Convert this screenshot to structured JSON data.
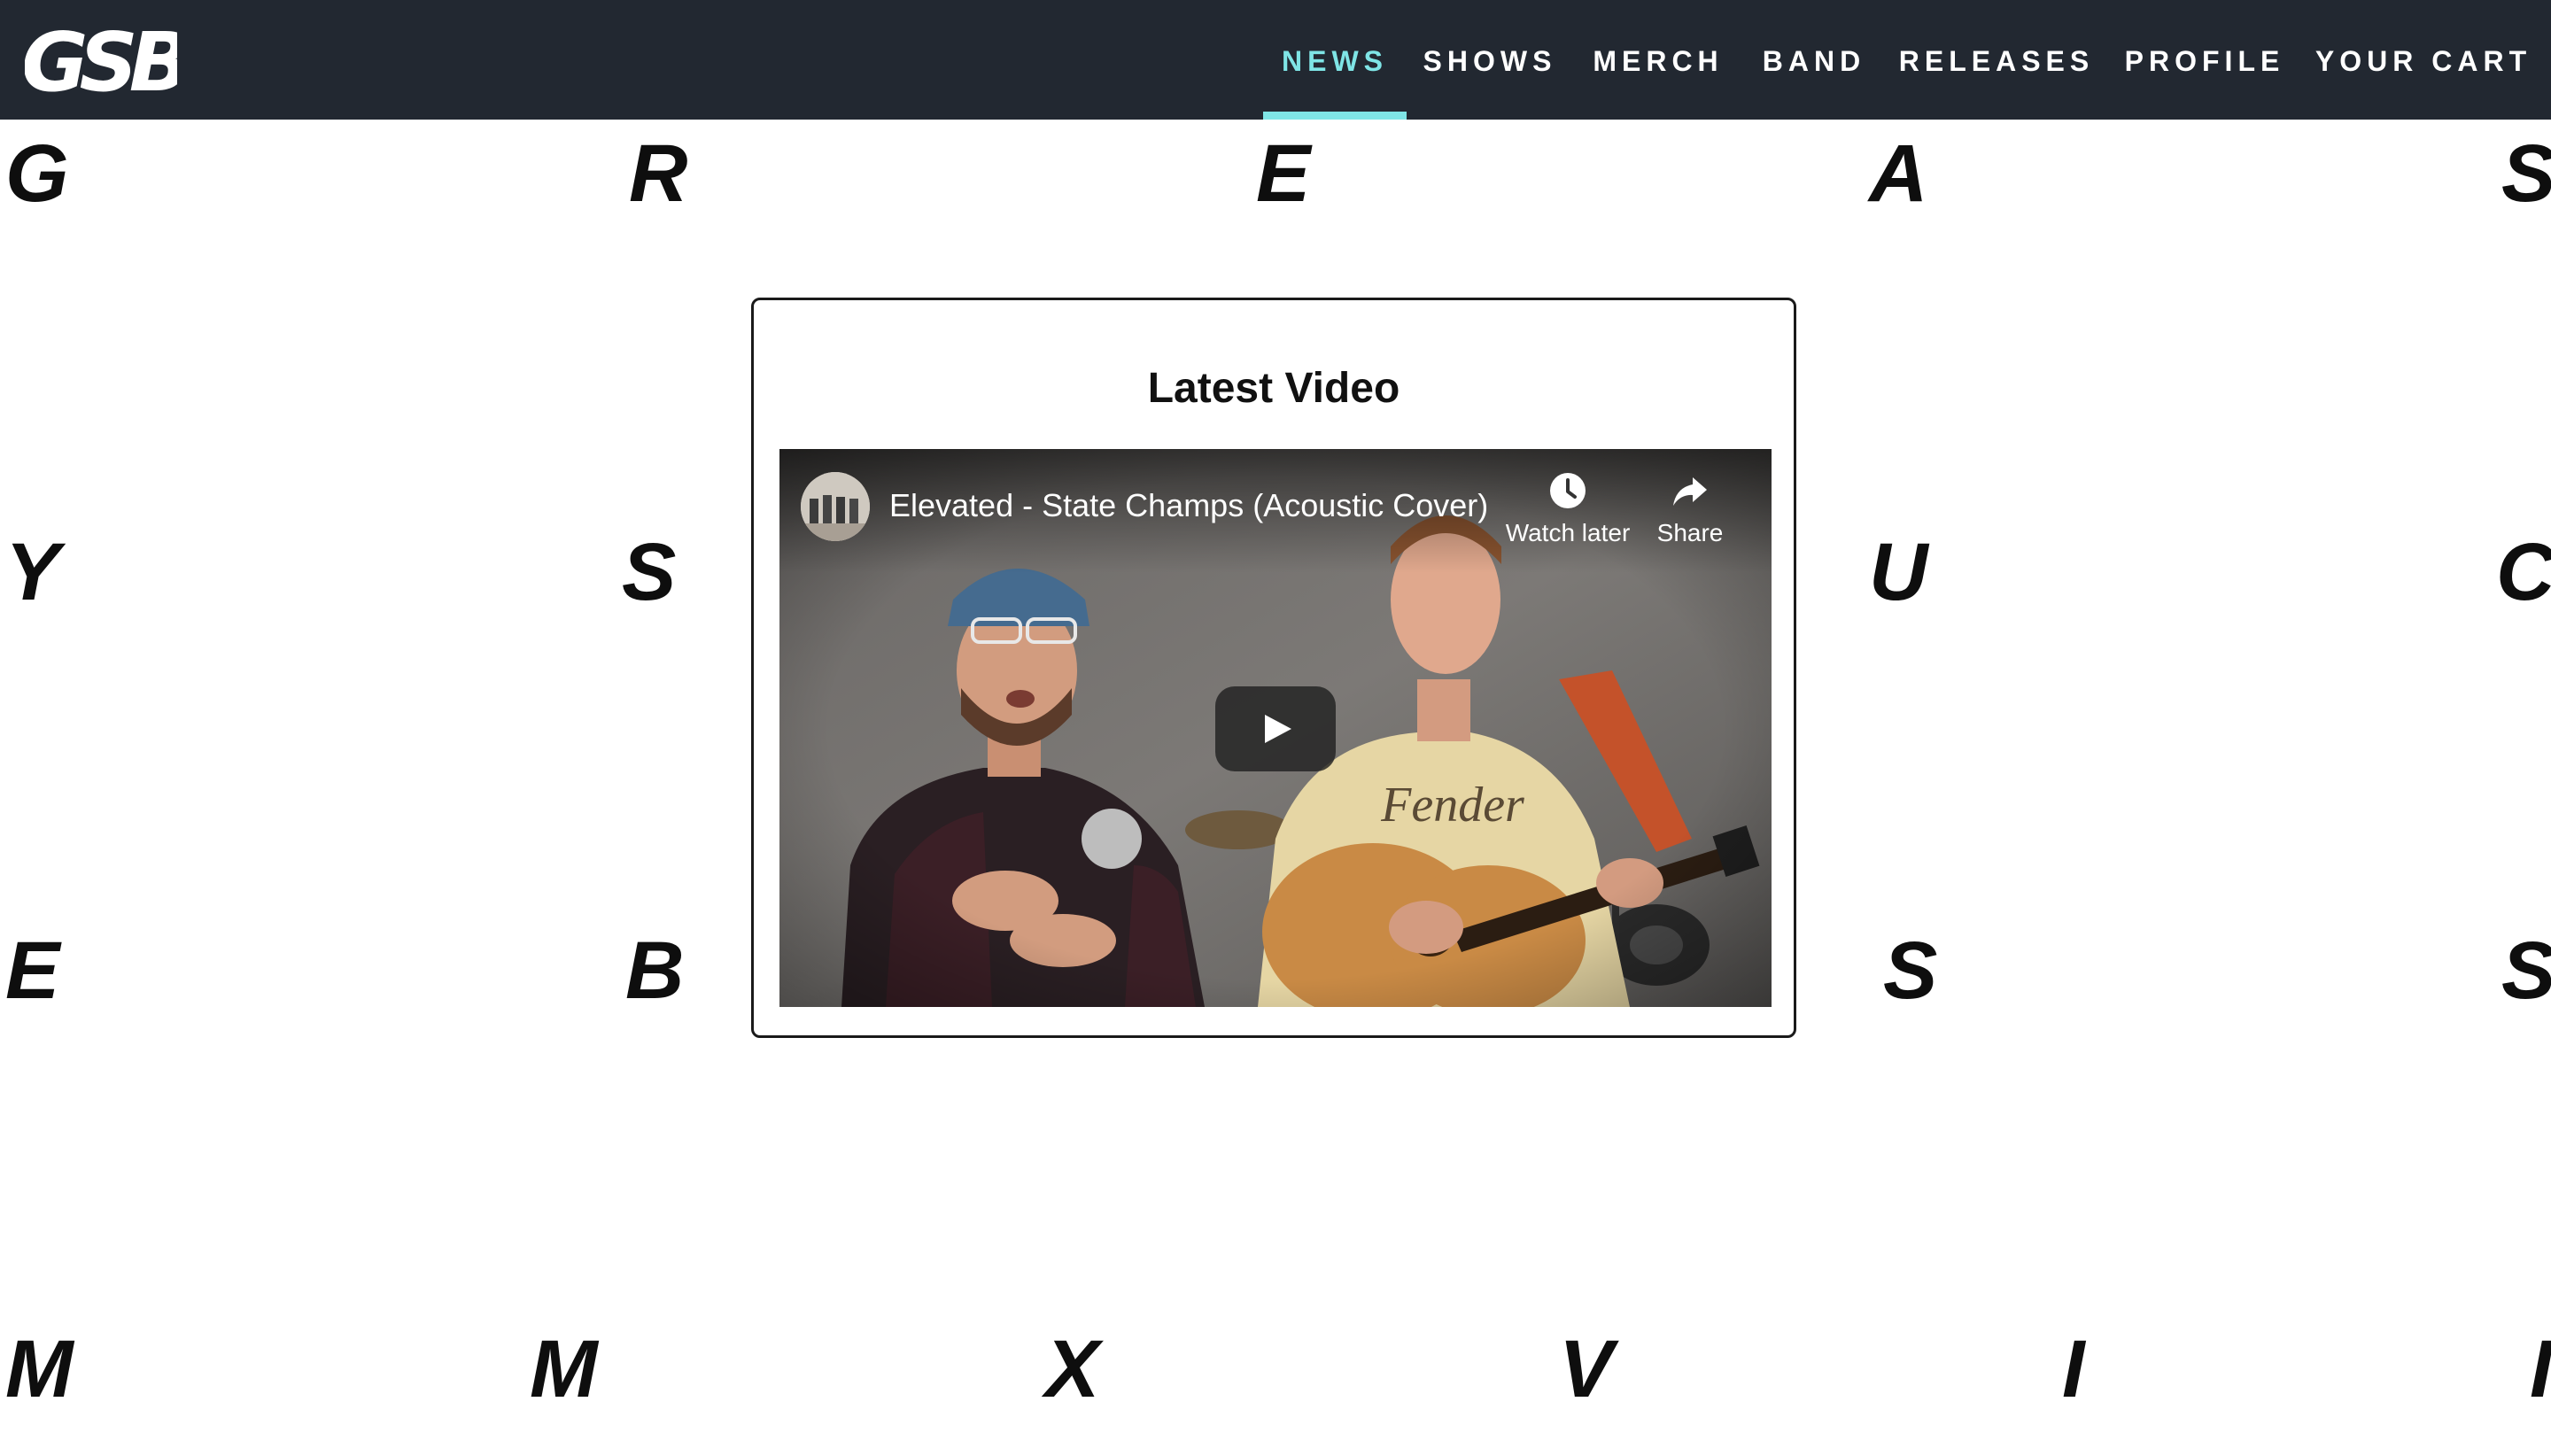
{
  "brand": {
    "logo_text": "GSB",
    "accent_color": "#7fe5e6",
    "navbar_color": "#222831"
  },
  "nav": {
    "items": [
      {
        "label": "NEWS",
        "active": true
      },
      {
        "label": "SHOWS",
        "active": false
      },
      {
        "label": "MERCH",
        "active": false
      },
      {
        "label": "BAND",
        "active": false
      },
      {
        "label": "RELEASES",
        "active": false
      },
      {
        "label": "PROFILE",
        "active": false
      },
      {
        "label": "YOUR CART",
        "active": false
      }
    ]
  },
  "background_letters": {
    "row1": [
      "G",
      "R",
      "E",
      "A",
      "S"
    ],
    "row2": [
      "Y",
      "S",
      "U",
      "C"
    ],
    "row3": [
      "E",
      "B",
      "S",
      "S"
    ],
    "row4": [
      "M",
      "M",
      "X",
      "V",
      "I",
      "I"
    ]
  },
  "latest_video": {
    "heading": "Latest Video",
    "video_title": "Elevated - State Champs (Acoustic Cover)",
    "actions": {
      "watch_later": "Watch later",
      "share": "Share"
    },
    "icons": {
      "watch_later": "clock-icon",
      "share": "share-arrow-icon",
      "play": "play-icon"
    }
  }
}
